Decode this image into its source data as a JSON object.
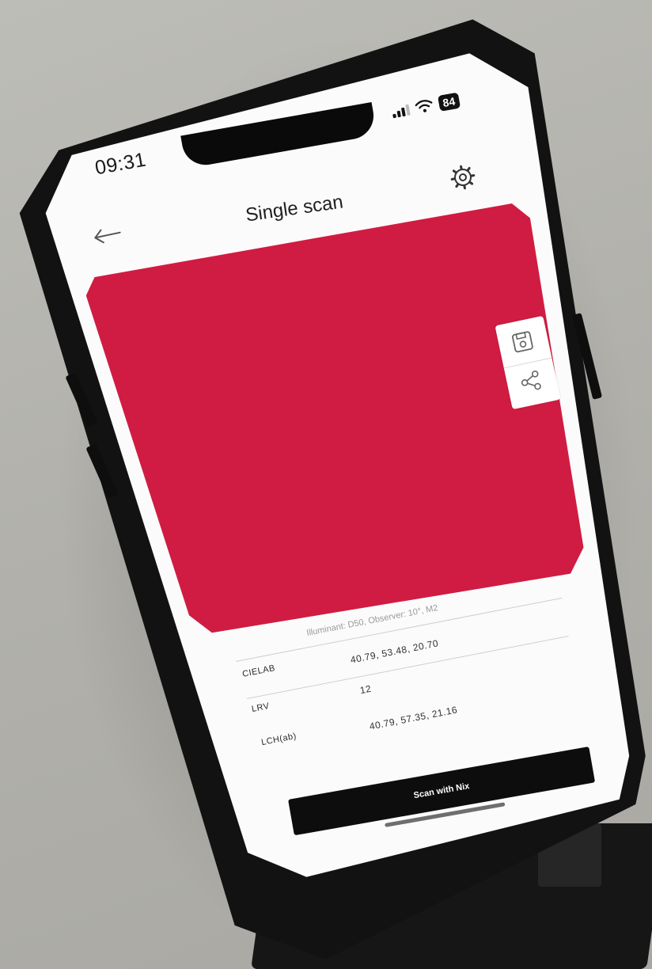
{
  "status_bar": {
    "time": "09:31",
    "battery": "84",
    "icons": [
      "signal-icon",
      "wifi-icon",
      "battery-icon"
    ]
  },
  "header": {
    "title": "Single scan",
    "back_icon": "arrow-left-icon",
    "settings_icon": "gear-icon"
  },
  "swatch": {
    "color": "#d01c42"
  },
  "side_actions": {
    "icons": [
      "save-icon",
      "share-icon"
    ]
  },
  "measurement": {
    "meta": "Illuminant: D50, Observer: 10°, M2",
    "rows": [
      {
        "label": "CIELAB",
        "value": "40.79, 53.48, 20.70"
      },
      {
        "label": "LRV",
        "value": "12"
      },
      {
        "label": "LCH(ab)",
        "value": "40.79, 57.35, 21.16"
      }
    ]
  },
  "footer": {
    "scan_label": "Scan with Nix"
  }
}
